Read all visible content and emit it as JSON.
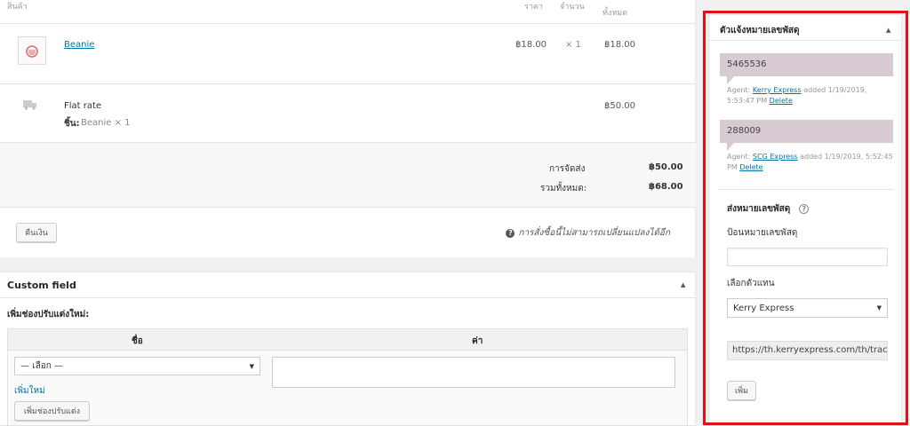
{
  "order_items": {
    "headers": {
      "item": "สินค้า",
      "cost": "ราคา",
      "qty": "จำนวน",
      "total": "ทั้งหมด"
    },
    "product": {
      "name": "Beanie",
      "cost": "฿18.00",
      "qty": "× 1",
      "total": "฿18.00",
      "icon": "product-image-icon"
    },
    "shipping": {
      "method": "Flat rate",
      "items_label": "ชิ้น:",
      "items_value": "Beanie × 1",
      "total": "฿50.00",
      "icon": "truck-icon"
    },
    "totals": {
      "shipping_label": "การจัดส่ง",
      "shipping_value": "฿50.00",
      "order_total_label": "รวมทั้งหมด:",
      "order_total_value": "฿68.00"
    },
    "refund_button": "คืนเงิน",
    "notice": "การสั่งซื้อนี้ไม่สามารถเปลี่ยนแปลงได้อีก"
  },
  "custom_field": {
    "title": "Custom field",
    "toggle": "▲",
    "subtitle": "เพิ่มช่องปรับแต่งใหม่:",
    "col_name": "ชื่อ",
    "col_value": "ค่า",
    "select_value": "— เลือก —",
    "add_new_link": "เพิ่มใหม่",
    "add_button": "เพิ่มช่องปรับแต่ง"
  },
  "tracking": {
    "title": "ตัวแจ้งหมายเลขพัสดุ",
    "toggle": "▲",
    "notes": [
      {
        "number": "5465536",
        "agent_label": "Agent:",
        "agent": "Kerry Express",
        "added": "added 1/19/2019, 5:53:47 PM",
        "delete": "Delete"
      },
      {
        "number": "288009",
        "agent_label": "Agent:",
        "agent": "SCG Express",
        "added": "added 1/19/2019, 5:52:45 PM",
        "delete": "Delete"
      }
    ],
    "form_title": "ส่งหมายเลขพัสดุ",
    "number_label": "ป้อนหมายเลขพัสดุ",
    "number_value": "",
    "agent_label": "เลือกตัวแทน",
    "agent_value": "Kerry Express",
    "url_value": "https://th.kerryexpress.com/th/track",
    "add_button": "เพิ่ม"
  },
  "colors": {
    "highlight_frame": "#e0101b",
    "note_bg": "#d7cad2",
    "link": "#0073aa"
  }
}
